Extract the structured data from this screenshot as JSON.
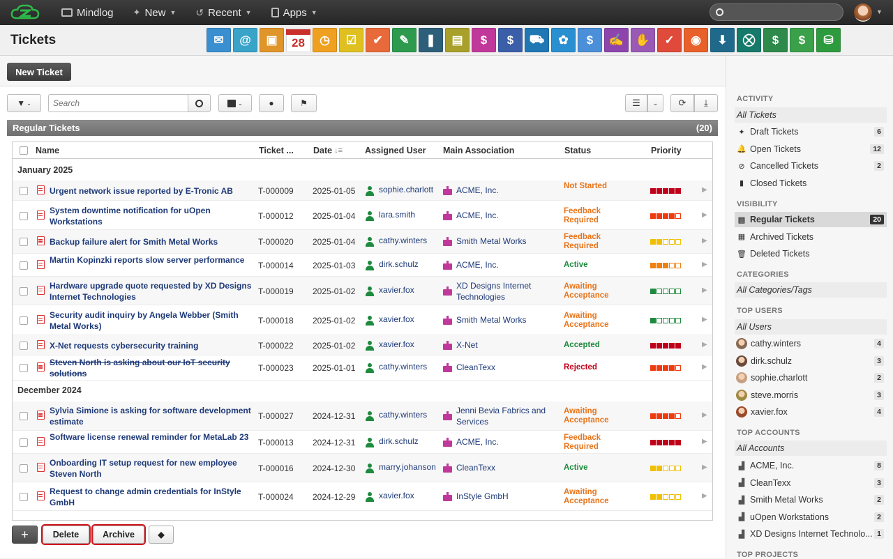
{
  "topnav": {
    "items": [
      {
        "label": "Mindlog",
        "icon": "mindlog-icon"
      },
      {
        "label": "New",
        "icon": "sparkle-icon"
      },
      {
        "label": "Recent",
        "icon": "history-icon"
      },
      {
        "label": "Apps",
        "icon": "tablet-icon"
      }
    ],
    "search_placeholder": ""
  },
  "header": {
    "title": "Tickets",
    "calendar_day": "28",
    "apps": [
      {
        "name": "mail-app-icon",
        "color": "#3a8fd0",
        "glyph": "✉"
      },
      {
        "name": "email-app-icon",
        "color": "#3aa3c8",
        "glyph": "@"
      },
      {
        "name": "contacts-app-icon",
        "color": "#e0952a",
        "glyph": "▣"
      },
      {
        "name": "calendar-app-icon",
        "color": "#c9302c",
        "glyph": "28"
      },
      {
        "name": "timer-app-icon",
        "color": "#f0a020",
        "glyph": "◷"
      },
      {
        "name": "tasks-app-icon",
        "color": "#e0c020",
        "glyph": "☑"
      },
      {
        "name": "projects-app-icon",
        "color": "#e86a3a",
        "glyph": "✔"
      },
      {
        "name": "notes-app-icon",
        "color": "#2e9a4e",
        "glyph": "✎"
      },
      {
        "name": "bookmarks-app-icon",
        "color": "#2e5f7a",
        "glyph": "❚"
      },
      {
        "name": "documents-app-icon",
        "color": "#a8a02a",
        "glyph": "▤"
      },
      {
        "name": "cashier-app-icon",
        "color": "#c0399a",
        "glyph": "$"
      },
      {
        "name": "finance-app-icon",
        "color": "#3a5fa8",
        "glyph": "$"
      },
      {
        "name": "delivery-app-icon",
        "color": "#1f78b4",
        "glyph": "⛟"
      },
      {
        "name": "support-app-icon",
        "color": "#2a8fd0",
        "glyph": "✿"
      },
      {
        "name": "money-bag-app-icon",
        "color": "#4a8fd8",
        "glyph": "$"
      },
      {
        "name": "contracts-app-icon",
        "color": "#8e44ad",
        "glyph": "✍"
      },
      {
        "name": "deals-app-icon",
        "color": "#9b59b6",
        "glyph": "✋"
      },
      {
        "name": "tickets-app-icon",
        "color": "#e04a3a",
        "glyph": "✓"
      },
      {
        "name": "broadcast-app-icon",
        "color": "#e8602a",
        "glyph": "◉"
      },
      {
        "name": "downloads-app-icon",
        "color": "#1f6a8a",
        "glyph": "⬇"
      },
      {
        "name": "shop-app-icon",
        "color": "#157a6a",
        "glyph": "⛒"
      },
      {
        "name": "billing-app-icon",
        "color": "#2e8a4a",
        "glyph": "$"
      },
      {
        "name": "pricing-app-icon",
        "color": "#3aa04a",
        "glyph": "$"
      },
      {
        "name": "database-app-icon",
        "color": "#2e9a3e",
        "glyph": "⛁"
      }
    ]
  },
  "toolbar": {
    "new_ticket": "New Ticket",
    "search_placeholder": "Search"
  },
  "panel": {
    "title": "Regular Tickets",
    "count": "(20)"
  },
  "table": {
    "columns": [
      "Name",
      "Ticket ...",
      "Date",
      "Assigned User",
      "Main Association",
      "Status",
      "Priority"
    ],
    "groups": [
      "January 2025",
      "December 2024"
    ],
    "rows": [
      {
        "name": "Urgent network issue reported by E-Tronic AB",
        "num": "T-000009",
        "date": "2025-01-05",
        "user": "sophie.charlott",
        "assoc": "ACME, Inc.",
        "status": "Not Started",
        "status_color": "#e8741a",
        "prio": 5,
        "prio_color": "#c0001a"
      },
      {
        "name": "System downtime notification for uOpen Workstations",
        "num": "T-000012",
        "date": "2025-01-04",
        "user": "lara.smith",
        "assoc": "ACME, Inc.",
        "status": "Feedback Required",
        "status_color": "#e8741a",
        "prio": 4,
        "prio_color": "#f03a10"
      },
      {
        "name": "Backup failure alert for Smith Metal Works",
        "num": "T-000020",
        "date": "2025-01-04",
        "user": "cathy.winters",
        "assoc": "Smith Metal Works",
        "status": "Feedback Required",
        "status_color": "#e8741a",
        "prio": 2,
        "prio_color": "#f0c000"
      },
      {
        "name": "Martin Kopinzki reports slow server performance",
        "num": "T-000014",
        "date": "2025-01-03",
        "user": "dirk.schulz",
        "assoc": "ACME, Inc.",
        "status": "Active",
        "status_color": "#1e8a3e",
        "prio": 3,
        "prio_color": "#f08010"
      },
      {
        "name": "Hardware upgrade quote requested by XD Designs Internet Technologies",
        "num": "T-000019",
        "date": "2025-01-02",
        "user": "xavier.fox",
        "assoc": "XD Designs Internet Technologies",
        "status": "Awaiting Acceptance",
        "status_color": "#e8741a",
        "prio": 1,
        "prio_color": "#1e8a3e"
      },
      {
        "name": "Security audit inquiry by Angela Webber (Smith Metal Works)",
        "num": "T-000018",
        "date": "2025-01-02",
        "user": "xavier.fox",
        "assoc": "Smith Metal Works",
        "status": "Awaiting Acceptance",
        "status_color": "#e8741a",
        "prio": 1,
        "prio_color": "#1e8a3e"
      },
      {
        "name": "X-Net requests cybersecurity training",
        "num": "T-000022",
        "date": "2025-01-02",
        "user": "xavier.fox",
        "assoc": "X-Net",
        "status": "Accepted",
        "status_color": "#1e8a3e",
        "prio": 5,
        "prio_color": "#c0001a"
      },
      {
        "name": "Steven North is asking about our IoT security solutions",
        "num": "T-000023",
        "date": "2025-01-01",
        "user": "cathy.winters",
        "assoc": "CleanTexx",
        "status": "Rejected",
        "status_color": "#c0001a",
        "prio": 4,
        "prio_color": "#f03a10",
        "strike": true
      },
      {
        "name": "Sylvia Simione is asking for software development estimate",
        "num": "T-000027",
        "date": "2024-12-31",
        "user": "cathy.winters",
        "assoc": "Jenni Bevia Fabrics and Services",
        "status": "Awaiting Acceptance",
        "status_color": "#e8741a",
        "prio": 4,
        "prio_color": "#f03a10"
      },
      {
        "name": "Software license renewal reminder for MetaLab 23",
        "num": "T-000013",
        "date": "2024-12-31",
        "user": "dirk.schulz",
        "assoc": "ACME, Inc.",
        "status": "Feedback Required",
        "status_color": "#e8741a",
        "prio": 5,
        "prio_color": "#c0001a"
      },
      {
        "name": "Onboarding IT setup request for new employee Steven North",
        "num": "T-000016",
        "date": "2024-12-30",
        "user": "marry.johanson",
        "assoc": "CleanTexx",
        "status": "Active",
        "status_color": "#1e8a3e",
        "prio": 2,
        "prio_color": "#f0c000"
      },
      {
        "name": "Request to change admin credentials for InStyle GmbH",
        "num": "T-000024",
        "date": "2024-12-29",
        "user": "xavier.fox",
        "assoc": "InStyle GmbH",
        "status": "Awaiting Acceptance",
        "status_color": "#e8741a",
        "prio": 2,
        "prio_color": "#f0c000"
      }
    ]
  },
  "bottom": {
    "delete": "Delete",
    "archive": "Archive"
  },
  "sidebar": {
    "activity_title": "ACTIVITY",
    "all_tickets": "All Tickets",
    "activity": [
      {
        "label": "Draft Tickets",
        "count": "6",
        "icon": "sparkle-icon",
        "glyph": "✦"
      },
      {
        "label": "Open Tickets",
        "count": "12",
        "icon": "bell-icon",
        "glyph": "🔔"
      },
      {
        "label": "Cancelled Tickets",
        "count": "2",
        "icon": "ban-icon",
        "glyph": "⊘"
      },
      {
        "label": "Closed Tickets",
        "count": "",
        "icon": "book-icon",
        "glyph": "▮"
      }
    ],
    "visibility_title": "VISIBILITY",
    "visibility": [
      {
        "label": "Regular Tickets",
        "count": "20",
        "icon": "inbox-icon",
        "glyph": "▤",
        "active": true
      },
      {
        "label": "Archived Tickets",
        "count": "",
        "icon": "archive-icon",
        "glyph": "▦"
      },
      {
        "label": "Deleted Tickets",
        "count": "",
        "icon": "trash-icon",
        "glyph": "🗑"
      }
    ],
    "categories_title": "CATEGORIES",
    "all_categories": "All Categories/Tags",
    "top_users_title": "TOP USERS",
    "all_users": "All Users",
    "users": [
      {
        "label": "cathy.winters",
        "count": "4",
        "color": "#8a6a50"
      },
      {
        "label": "dirk.schulz",
        "count": "3",
        "color": "#6a4a3a"
      },
      {
        "label": "sophie.charlott",
        "count": "2",
        "color": "#c8a080"
      },
      {
        "label": "steve.morris",
        "count": "3",
        "color": "#a08a40"
      },
      {
        "label": "xavier.fox",
        "count": "4",
        "color": "#9a4a2a"
      }
    ],
    "top_accounts_title": "TOP ACCOUNTS",
    "all_accounts": "All Accounts",
    "accounts": [
      {
        "label": "ACME, Inc.",
        "count": "8"
      },
      {
        "label": "CleanTexx",
        "count": "3"
      },
      {
        "label": "Smith Metal Works",
        "count": "2"
      },
      {
        "label": "uOpen Workstations",
        "count": "2"
      },
      {
        "label": "XD Designs Internet Technolo...",
        "count": "1"
      }
    ],
    "top_projects_title": "TOP PROJECTS"
  }
}
